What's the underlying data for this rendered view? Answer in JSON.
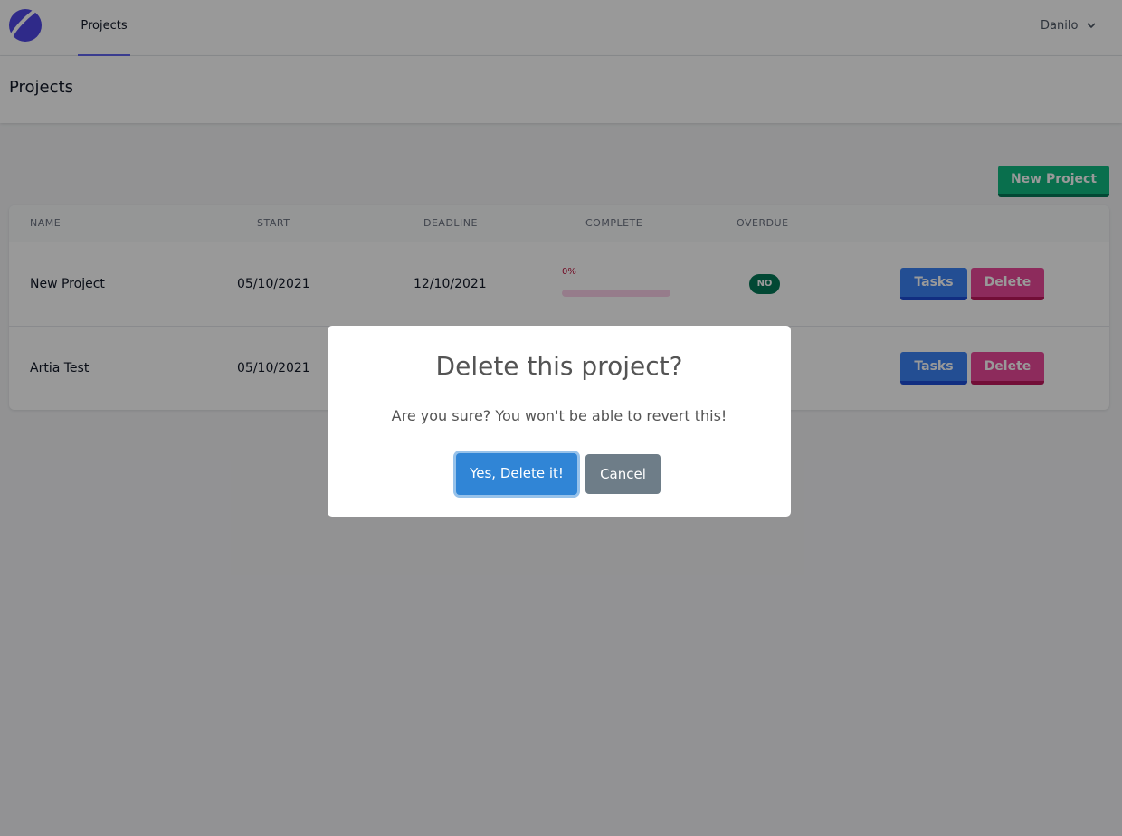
{
  "nav": {
    "logo": "logo-icon",
    "tab_projects": "Projects",
    "user_name": "Danilo",
    "user_menu_icon": "chevron-down-icon"
  },
  "header": {
    "title": "Projects"
  },
  "actions": {
    "new_project": "New Project"
  },
  "table": {
    "columns": [
      "NAME",
      "START",
      "DEADLINE",
      "COMPLETE",
      "OVERDUE"
    ],
    "rows": [
      {
        "name": "New Project",
        "start": "05/10/2021",
        "deadline": "12/10/2021",
        "complete": "0%",
        "complete_value": 0,
        "overdue": "NO",
        "tasks": "Tasks",
        "delete": "Delete"
      },
      {
        "name": "Artia Test",
        "start": "05/10/2021",
        "tasks": "Tasks",
        "delete": "Delete"
      }
    ]
  },
  "modal": {
    "title": "Delete this project?",
    "text": "Are you sure? You won't be able to revert this!",
    "confirm": "Yes, Delete it!",
    "cancel": "Cancel"
  },
  "colors": {
    "accent": "#6366f1",
    "success": "#10b981",
    "tasks": "#3b82f6",
    "delete": "#ec4899",
    "confirm": "#3085d6",
    "cancel": "#6e7d88"
  }
}
